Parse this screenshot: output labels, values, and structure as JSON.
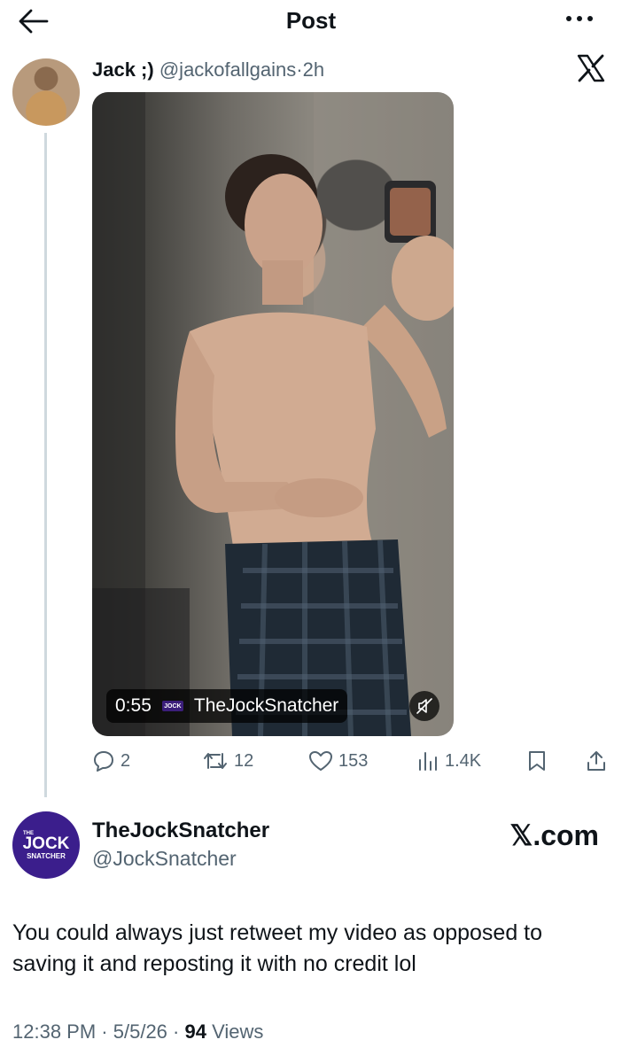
{
  "header": {
    "title": "Post",
    "back_icon": "arrow-left-icon",
    "more_icon": "more-horizontal-icon"
  },
  "tweet1": {
    "author_name": "Jack ;)",
    "author_handle": "@jackofallgains",
    "separator": "·",
    "time": "2h",
    "source_icon": "x-logo-icon",
    "video": {
      "duration": "0:55",
      "source_badge": "JOCK",
      "source_name": "TheJockSnatcher",
      "mute_icon": "muted-speaker-icon"
    },
    "stats": {
      "replies": "2",
      "reposts": "12",
      "likes": "153",
      "views": "1.4K"
    }
  },
  "tweet2": {
    "author_name": "TheJockSnatcher",
    "author_handle": "@JockSnatcher",
    "avatar_text_top": "THE",
    "avatar_text_main": "JOCK",
    "avatar_text_bottom": "SNATCHER",
    "site_label": "𝕏.com",
    "text": "You could always just retweet my video as opposed to saving it and reposting it with no credit lol",
    "time": "12:38 PM",
    "separator": "·",
    "date": "5/5/26",
    "views_count": "94",
    "views_label": "Views"
  },
  "colors": {
    "text": "#0f1419",
    "muted": "#536471",
    "thread_line": "#cfd9de",
    "brand_purple": "#3b1e8c"
  }
}
